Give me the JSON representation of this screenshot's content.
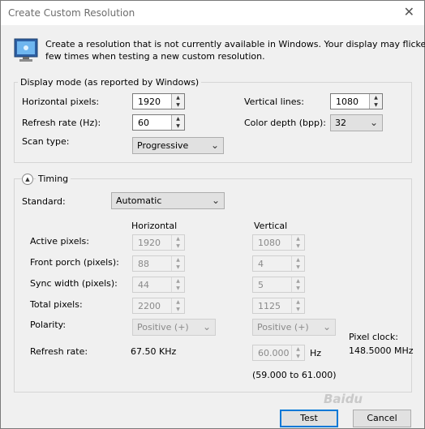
{
  "window": {
    "title": "Create Custom Resolution"
  },
  "intro": {
    "line1": "Create a resolution that is not currently available in Windows. Your display may flicker a",
    "line2": "few times when testing a new custom resolution."
  },
  "display_mode": {
    "legend": "Display mode (as reported by Windows)",
    "horizontal_pixels_label": "Horizontal pixels:",
    "horizontal_pixels_value": "1920",
    "vertical_lines_label": "Vertical lines:",
    "vertical_lines_value": "1080",
    "refresh_rate_label": "Refresh rate (Hz):",
    "refresh_rate_value": "60",
    "color_depth_label": "Color depth (bpp):",
    "color_depth_value": "32",
    "scan_type_label": "Scan type:",
    "scan_type_value": "Progressive"
  },
  "timing": {
    "legend": "Timing",
    "standard_label": "Standard:",
    "standard_value": "Automatic",
    "horizontal_header": "Horizontal",
    "vertical_header": "Vertical",
    "active_pixels_label": "Active pixels:",
    "active_h": "1920",
    "active_v": "1080",
    "front_porch_label": "Front porch (pixels):",
    "front_porch_h": "88",
    "front_porch_v": "4",
    "sync_width_label": "Sync width (pixels):",
    "sync_width_h": "44",
    "sync_width_v": "5",
    "total_pixels_label": "Total pixels:",
    "total_h": "2200",
    "total_v": "1125",
    "polarity_label": "Polarity:",
    "polarity_h": "Positive (+)",
    "polarity_v": "Positive (+)",
    "refresh_rate_label": "Refresh rate:",
    "refresh_rate_h": "67.50 KHz",
    "refresh_rate_v": "60.000",
    "refresh_unit": "Hz",
    "refresh_range": "(59.000 to 61.000)",
    "pixel_clock_label": "Pixel clock:",
    "pixel_clock_value": "148.5000 MHz"
  },
  "buttons": {
    "test": "Test",
    "cancel": "Cancel"
  },
  "watermark": "Baidu"
}
